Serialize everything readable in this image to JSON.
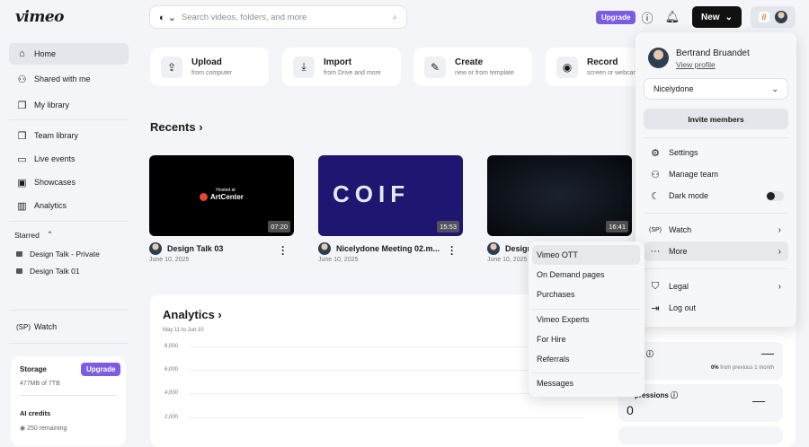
{
  "header": {
    "logo": "vimeo",
    "search_placeholder": "Search videos, folders, and more",
    "upgrade": "Upgrade",
    "new": "New"
  },
  "sidebar": {
    "items": [
      {
        "label": "Home",
        "icon": "home-icon"
      },
      {
        "label": "Shared with me",
        "icon": "users-icon"
      },
      {
        "label": "My library",
        "icon": "library-icon"
      },
      {
        "label": "Team library",
        "icon": "team-library-icon"
      },
      {
        "label": "Live events",
        "icon": "camera-icon"
      },
      {
        "label": "Showcases",
        "icon": "showcase-icon"
      },
      {
        "label": "Analytics",
        "icon": "analytics-icon"
      }
    ],
    "starred_label": "Starred",
    "starred": [
      "Design Talk - Private",
      "Design Talk 01"
    ],
    "watch": "Watch",
    "storage": {
      "label": "Storage",
      "upgrade": "Upgrade",
      "value": "477MB of 7TB"
    },
    "ai": {
      "label": "AI credits",
      "value": "250 remaining"
    }
  },
  "quick_actions": [
    {
      "title": "Upload",
      "sub": "from computer"
    },
    {
      "title": "Import",
      "sub": "from Drive and more"
    },
    {
      "title": "Create",
      "sub": "new or from template"
    },
    {
      "title": "Record",
      "sub": "screen or webcam"
    }
  ],
  "recents": {
    "title": "Recents",
    "videos": [
      {
        "title": "Design Talk 03",
        "date": "June 10, 2025",
        "duration": "07:20",
        "thumb_text1": "Hosted at",
        "thumb_text2": "ArtCenter"
      },
      {
        "title": "Nicelydone Meeting 02.m...",
        "date": "June 10, 2025",
        "duration": "15:53",
        "thumb_text1": "COIF"
      },
      {
        "title": "Design",
        "date": "June 10, 2025",
        "duration": "16:41"
      }
    ]
  },
  "analytics": {
    "title": "Analytics",
    "range": "May 11 to Jun 10",
    "ticks": [
      "8,000",
      "6,000",
      "4,000",
      "2,000"
    ],
    "stats": [
      {
        "label": "ws",
        "value": "—",
        "change": "0%",
        "change_sub": "from previous 1 month"
      },
      {
        "label": "pressions",
        "value": "0",
        "dash": "—"
      }
    ]
  },
  "profile": {
    "name": "Bertrand Bruandet",
    "view": "View profile",
    "team": "Nicelydone",
    "invite": "Invite members",
    "items": [
      {
        "label": "Settings",
        "icon": "gear-icon"
      },
      {
        "label": "Manage team",
        "icon": "team-icon"
      },
      {
        "label": "Dark mode",
        "icon": "moon-icon"
      },
      {
        "label": "Watch",
        "icon": "watch-icon"
      },
      {
        "label": "More",
        "icon": "more-icon"
      },
      {
        "label": "Legal",
        "icon": "shield-icon"
      },
      {
        "label": "Log out",
        "icon": "logout-icon"
      }
    ]
  },
  "more_menu": [
    "Vimeo OTT",
    "On Demand pages",
    "Purchases",
    "Vimeo Experts",
    "For Hire",
    "Referrals",
    "Messages"
  ],
  "colors": {
    "accent": "#7c5ce0",
    "primary": "#111111"
  }
}
